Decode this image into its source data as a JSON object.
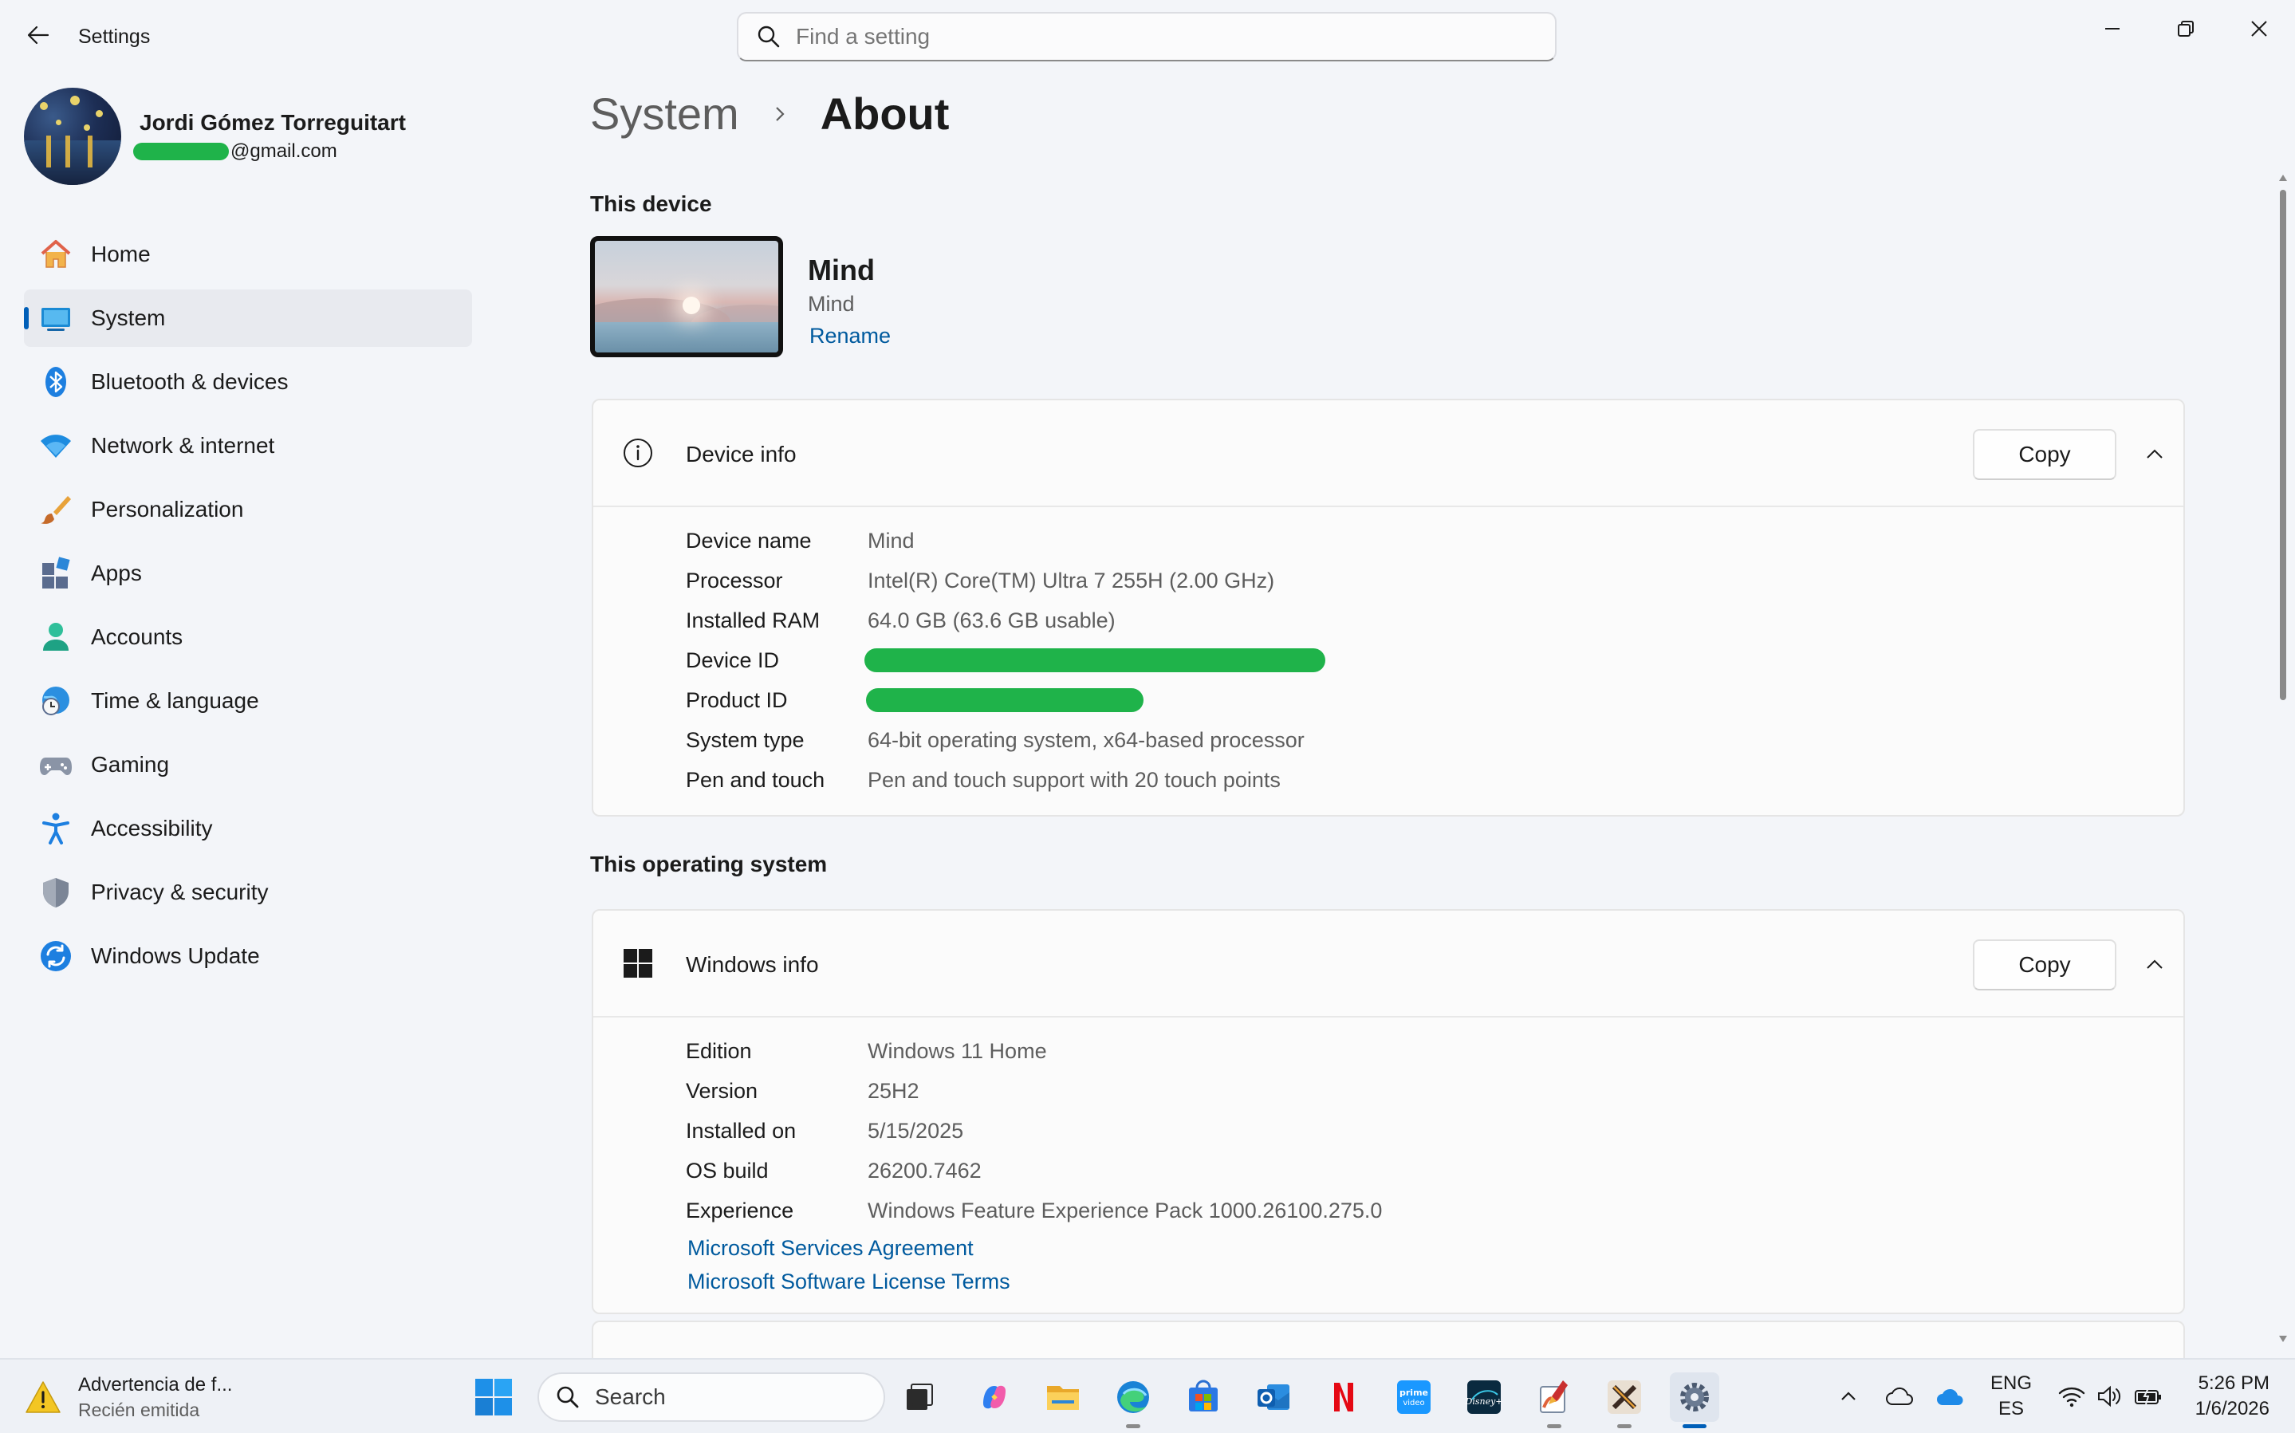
{
  "app": {
    "title": "Settings",
    "search_placeholder": "Find a setting"
  },
  "profile": {
    "name": "Jordi Gómez Torreguitart",
    "email_suffix": "@gmail.com"
  },
  "sidebar": {
    "items": [
      {
        "label": "Home",
        "icon": "home-icon",
        "active": false
      },
      {
        "label": "System",
        "icon": "system-icon",
        "active": true
      },
      {
        "label": "Bluetooth & devices",
        "icon": "bluetooth-icon",
        "active": false
      },
      {
        "label": "Network & internet",
        "icon": "wifi-icon",
        "active": false
      },
      {
        "label": "Personalization",
        "icon": "brush-icon",
        "active": false
      },
      {
        "label": "Apps",
        "icon": "apps-icon",
        "active": false
      },
      {
        "label": "Accounts",
        "icon": "person-icon",
        "active": false
      },
      {
        "label": "Time & language",
        "icon": "globe-clock-icon",
        "active": false
      },
      {
        "label": "Gaming",
        "icon": "gamepad-icon",
        "active": false
      },
      {
        "label": "Accessibility",
        "icon": "accessibility-icon",
        "active": false
      },
      {
        "label": "Privacy & security",
        "icon": "shield-icon",
        "active": false
      },
      {
        "label": "Windows Update",
        "icon": "update-icon",
        "active": false
      }
    ]
  },
  "breadcrumb": {
    "parent": "System",
    "current": "About"
  },
  "this_device": {
    "section_label": "This device",
    "device_name": "Mind",
    "device_model": "Mind",
    "rename_label": "Rename"
  },
  "device_info": {
    "title": "Device info",
    "copy_label": "Copy",
    "rows": [
      {
        "label": "Device name",
        "value": "Mind"
      },
      {
        "label": "Processor",
        "value": "Intel(R) Core(TM) Ultra 7 255H (2.00 GHz)"
      },
      {
        "label": "Installed RAM",
        "value": "64.0 GB (63.6 GB usable)"
      },
      {
        "label": "Device ID",
        "value": ""
      },
      {
        "label": "Product ID",
        "value": ""
      },
      {
        "label": "System type",
        "value": "64-bit operating system, x64-based processor"
      },
      {
        "label": "Pen and touch",
        "value": "Pen and touch support with 20 touch points"
      }
    ]
  },
  "operating_system": {
    "section_label": "This operating system"
  },
  "windows_info": {
    "title": "Windows info",
    "copy_label": "Copy",
    "rows": [
      {
        "label": "Edition",
        "value": "Windows 11 Home"
      },
      {
        "label": "Version",
        "value": "25H2"
      },
      {
        "label": "Installed on",
        "value": "5/15/2025"
      },
      {
        "label": "OS build",
        "value": "26200.7462"
      },
      {
        "label": "Experience",
        "value": "Windows Feature Experience Pack 1000.26100.275.0"
      }
    ],
    "links": [
      "Microsoft Services Agreement",
      "Microsoft Software License Terms"
    ]
  },
  "taskbar": {
    "notification_title": "Advertencia de f...",
    "notification_subtitle": "Recién emitida",
    "search_label": "Search",
    "lang_primary": "ENG",
    "lang_secondary": "ES",
    "time": "5:26 PM",
    "date": "1/6/2026",
    "apps": [
      "task-view-icon",
      "copilot-icon",
      "file-explorer-icon",
      "edge-icon",
      "store-icon",
      "outlook-icon",
      "netflix-icon",
      "prime-video-icon",
      "disney-plus-icon",
      "paint-icon",
      "capcut-icon",
      "settings-icon"
    ]
  },
  "colors": {
    "accent": "#005fb8",
    "link": "#005a9e",
    "redaction": "#1fb34a",
    "background": "#f3f5f9"
  }
}
